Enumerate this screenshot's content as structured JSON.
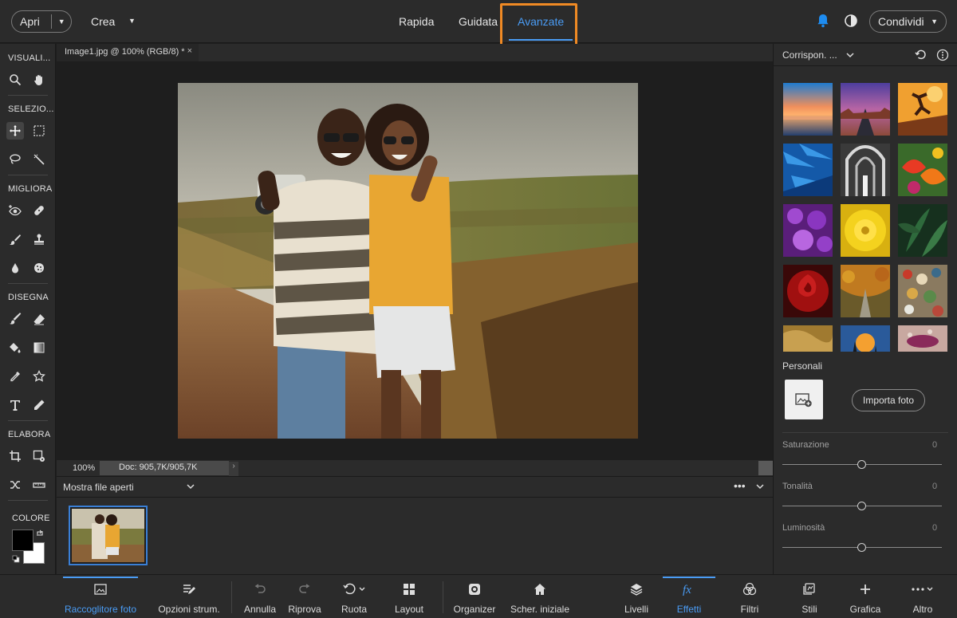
{
  "header": {
    "open_label": "Apri",
    "create_label": "Crea",
    "modes": [
      "Rapida",
      "Guidata",
      "Avanzate"
    ],
    "active_mode": "Avanzate",
    "share_label": "Condividi"
  },
  "toolbar": {
    "sections": {
      "view": "VISUALI...",
      "select": "SELEZIO...",
      "enhance": "MIGLIORA",
      "draw": "DISEGNA",
      "modify": "ELABORA",
      "color": "COLORE"
    }
  },
  "document": {
    "tab_title": "Image1.jpg @ 100% (RGB/8) *",
    "tab_close": "×",
    "zoom": "100%",
    "doc_size": "Doc: 905,7K/905,7K",
    "status_arrow": "›"
  },
  "photo_bin": {
    "label": "Mostra file aperti",
    "more": "•••"
  },
  "right_panel": {
    "title": "Corrispon. ...",
    "personal_label": "Personali",
    "import_label": "Importa foto",
    "sliders": [
      {
        "label": "Saturazione",
        "value": "0"
      },
      {
        "label": "Tonalità",
        "value": "0"
      },
      {
        "label": "Luminosità",
        "value": "0"
      }
    ]
  },
  "bottom_bar": {
    "photo_bin": "Raccoglitore foto",
    "tool_options": "Opzioni strum.",
    "undo": "Annulla",
    "redo": "Riprova",
    "rotate": "Ruota",
    "layout": "Layout",
    "organizer": "Organizer",
    "home": "Scher. iniziale",
    "layers": "Livelli",
    "effects": "Effetti",
    "filters": "Filtri",
    "styles": "Stili",
    "graphics": "Grafica",
    "more": "Altro",
    "active": "Effetti"
  },
  "colors": {
    "accent": "#4a9cf5",
    "highlight": "#f08a24",
    "bell": "#1e8cf0"
  }
}
